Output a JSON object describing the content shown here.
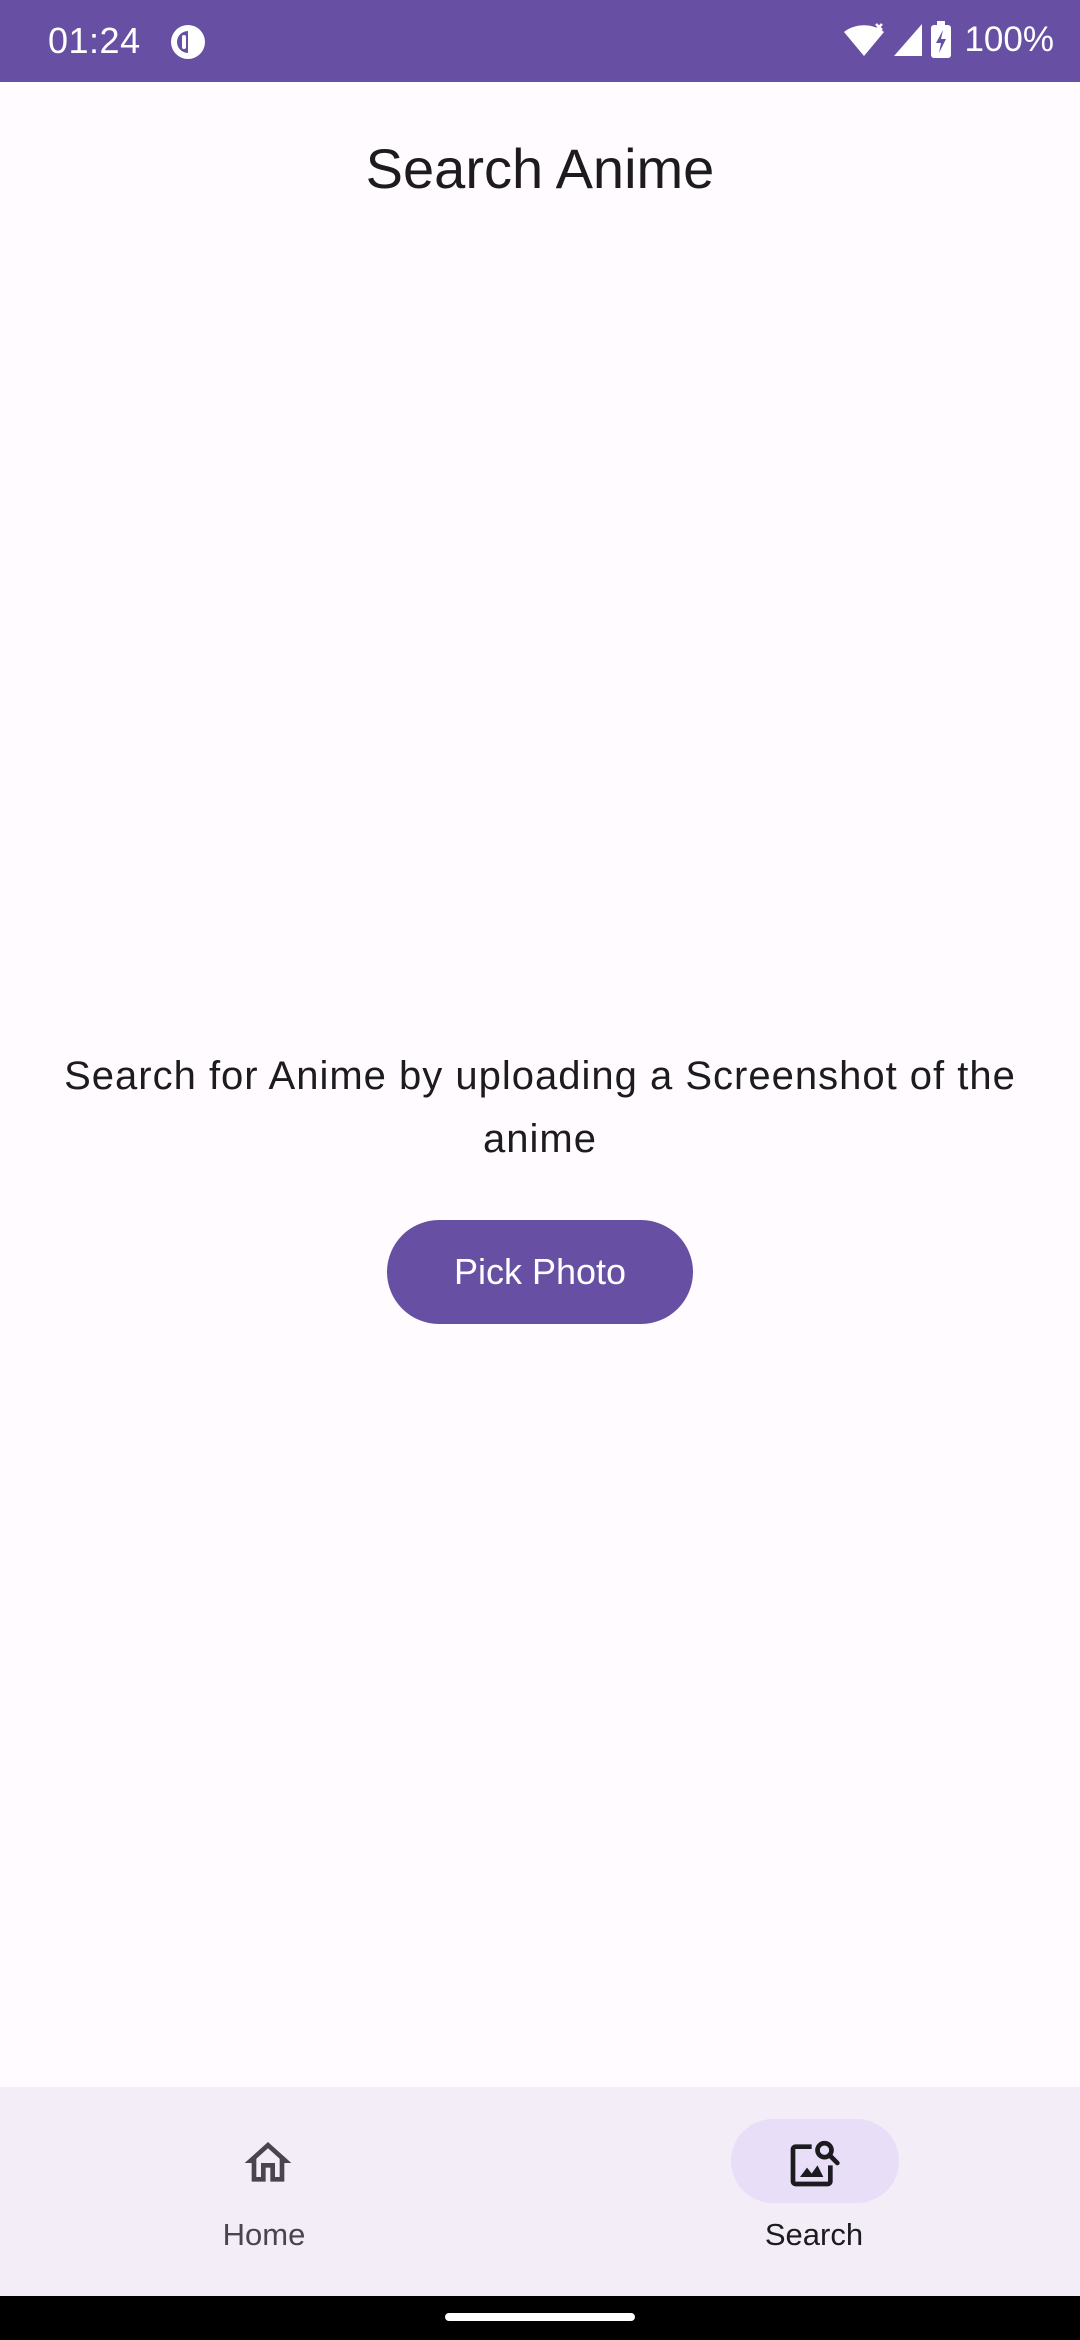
{
  "status_bar": {
    "time": "01:24",
    "battery": "100%",
    "icons": [
      "app-notification-icon",
      "wifi-icon",
      "signal-icon",
      "battery-charging-icon"
    ]
  },
  "header": {
    "title": "Search Anime"
  },
  "main": {
    "prompt": "Search for Anime by uploading a Screenshot of the anime",
    "button_label": "Pick Photo"
  },
  "bottom_nav": {
    "items": [
      {
        "label": "Home",
        "icon": "home-icon",
        "selected": false
      },
      {
        "label": "Search",
        "icon": "image-search-icon",
        "selected": true
      }
    ]
  },
  "colors": {
    "primary": "#6750A4",
    "background": "#FFFBFE",
    "nav_background": "#F3EDF7",
    "nav_indicator": "#E8DEF8",
    "text": "#1C1B1F"
  }
}
